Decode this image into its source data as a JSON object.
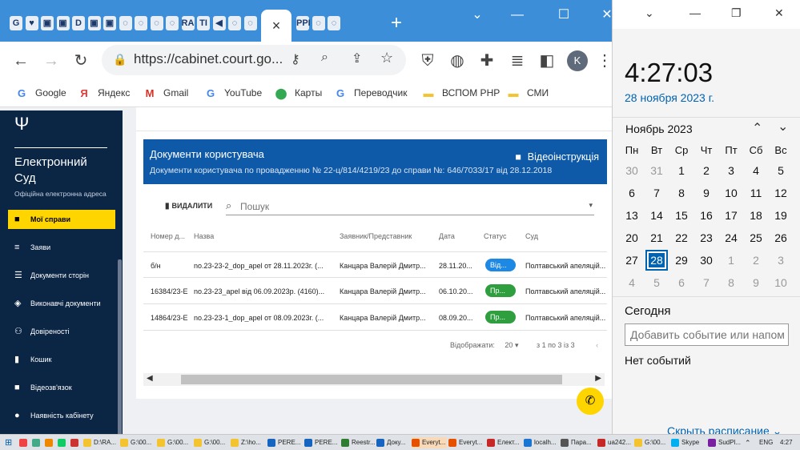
{
  "browser": {
    "url": "https://cabinet.court.go...",
    "tab_close": "×",
    "new_tab": "+",
    "profile_initial": "K",
    "tab_icons": [
      "G",
      "♥",
      "▣",
      "▣",
      "D",
      "▣",
      "▣",
      "◌",
      "◌",
      "◌",
      "◌",
      "RA",
      "TI",
      "◀",
      "◌",
      "◌",
      "PPI",
      "◌",
      "◌"
    ],
    "bookmarks": [
      {
        "label": "Google",
        "icon": "G",
        "color": "#4285f4"
      },
      {
        "label": "Яндекс",
        "icon": "Я",
        "color": "#e53935"
      },
      {
        "label": "Gmail",
        "icon": "M",
        "color": "#d93025"
      },
      {
        "label": "YouTube",
        "icon": "G",
        "color": "#4285f4"
      },
      {
        "label": "Карты",
        "icon": "⬤",
        "color": "#34a853"
      },
      {
        "label": "Переводчик",
        "icon": "G",
        "color": "#4285f4"
      },
      {
        "label": "ВСПОМ РНР",
        "icon": "▬",
        "color": "#f4c430"
      },
      {
        "label": "СМИ",
        "icon": "▬",
        "color": "#f4c430"
      }
    ]
  },
  "sidebar": {
    "brand_line1": "Електронний",
    "brand_line2": "Суд",
    "brand_sub": "Офіційна електронна адреса",
    "items": [
      {
        "label": "Мої справи",
        "icon": "■",
        "active": true
      },
      {
        "label": "Заяви",
        "icon": "≡"
      },
      {
        "label": "Документи сторін",
        "icon": "☰"
      },
      {
        "label": "Виконавчі документи",
        "icon": "◈"
      },
      {
        "label": "Довіреності",
        "icon": "⚇"
      },
      {
        "label": "Кошик",
        "icon": "▮"
      },
      {
        "label": "Відеозв'язок",
        "icon": "■"
      },
      {
        "label": "Наявність кабінету",
        "icon": "●"
      }
    ]
  },
  "documents": {
    "title": "Документи користувача",
    "subtitle": "Документи користувача по провадженню № 22-ц/814/4219/23 до справи №: 646/7033/17 від 28.12.2018",
    "video_label": "Відеоінструкція",
    "delete_label": "ВИДАЛИТИ",
    "search_placeholder": "Пошук",
    "columns": [
      "Номер д...",
      "Назва",
      "Заявник/Представник",
      "Дата",
      "Статус",
      "Суд"
    ],
    "rows": [
      {
        "number": "б/н",
        "name": "no.23-23-2_dop_apel от 28.11.2023г. (...",
        "applicant": "Канцара Валерій Дмитр...",
        "date": "28.11.20...",
        "status": "Від...",
        "status_color": "#1e88e5",
        "court": "Полтавський апеляцій..."
      },
      {
        "number": "16384/23-Е",
        "name": "no.23-23_apel від 06.09.2023р. (4160)...",
        "applicant": "Канцара Валерій Дмитр...",
        "date": "06.10.20...",
        "status": "Пр...",
        "status_color": "#2e9e3e",
        "court": "Полтавський апеляцій..."
      },
      {
        "number": "14864/23-Е",
        "name": "no.23-23-1_dop_apel от 08.09.2023г. (...",
        "applicant": "Канцара Валерій Дмитр...",
        "date": "08.09.20...",
        "status": "Пр...",
        "status_color": "#2e9e3e",
        "court": "Полтавський апеляцій..."
      }
    ],
    "pager_label": "Відображати:",
    "pager_size": "20",
    "pager_range": "з 1 по 3 із 3"
  },
  "clock": {
    "time": "4:27:03",
    "date": "28 ноября 2023 г.",
    "month": "Ноябрь 2023",
    "weekdays": [
      "Пн",
      "Вт",
      "Ср",
      "Чт",
      "Пт",
      "Сб",
      "Вс"
    ],
    "days": [
      [
        "30",
        "31",
        "1",
        "2",
        "3",
        "4",
        "5"
      ],
      [
        "6",
        "7",
        "8",
        "9",
        "10",
        "11",
        "12"
      ],
      [
        "13",
        "14",
        "15",
        "16",
        "17",
        "18",
        "19"
      ],
      [
        "20",
        "21",
        "22",
        "23",
        "24",
        "25",
        "26"
      ],
      [
        "27",
        "28",
        "29",
        "30",
        "1",
        "2",
        "3"
      ],
      [
        "4",
        "5",
        "6",
        "7",
        "8",
        "9",
        "10"
      ]
    ],
    "today_day": "28",
    "today_label": "Сегодня",
    "event_placeholder": "Добавить событие или напом",
    "no_events": "Нет событий",
    "hide_schedule": "Скрыть расписание"
  },
  "taskbar": {
    "items": [
      "D:\\RA...",
      "G:\\00...",
      "G:\\00...",
      "G:\\00...",
      "Z:\\ho...",
      "PERE...",
      "PERE...",
      "Reestr...",
      "Доку...",
      "Everyt...",
      "Everyt...",
      "Елект...",
      "localh...",
      "Пара...",
      "ua242...",
      "G:\\00...",
      "Skype",
      "SudPl..."
    ],
    "lang": "ENG",
    "time": "4:27"
  }
}
